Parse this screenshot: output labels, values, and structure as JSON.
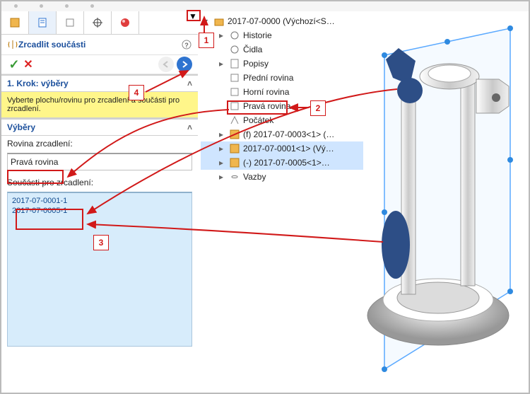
{
  "panel": {
    "title": "Zrcadlit součásti",
    "step1": "1. Krok: výběry",
    "hint": "Vyberte plochu/rovinu pro zrcadlení a součásti pro zrcadlení.",
    "selections": "Výběry",
    "plane_label": "Rovina zrcadlení:",
    "plane_value": "Pravá rovina",
    "components_label": "Součásti pro zrcadlení:",
    "components": [
      "2017-07-0001-1",
      "2017-07-0005-1"
    ]
  },
  "tree": {
    "root": "2017-07-0000  (Výchozí<S…",
    "items": [
      "Historie",
      "Čidla",
      "Popisy",
      "Přední rovina",
      "Horní rovina",
      "Pravá rovina",
      "Počátek",
      "(f) 2017-07-0003<1> (…",
      "2017-07-0001<1> (Vý…",
      "(-) 2017-07-0005<1>…",
      "Vazby"
    ]
  },
  "callouts": [
    "1",
    "2",
    "3",
    "4"
  ]
}
